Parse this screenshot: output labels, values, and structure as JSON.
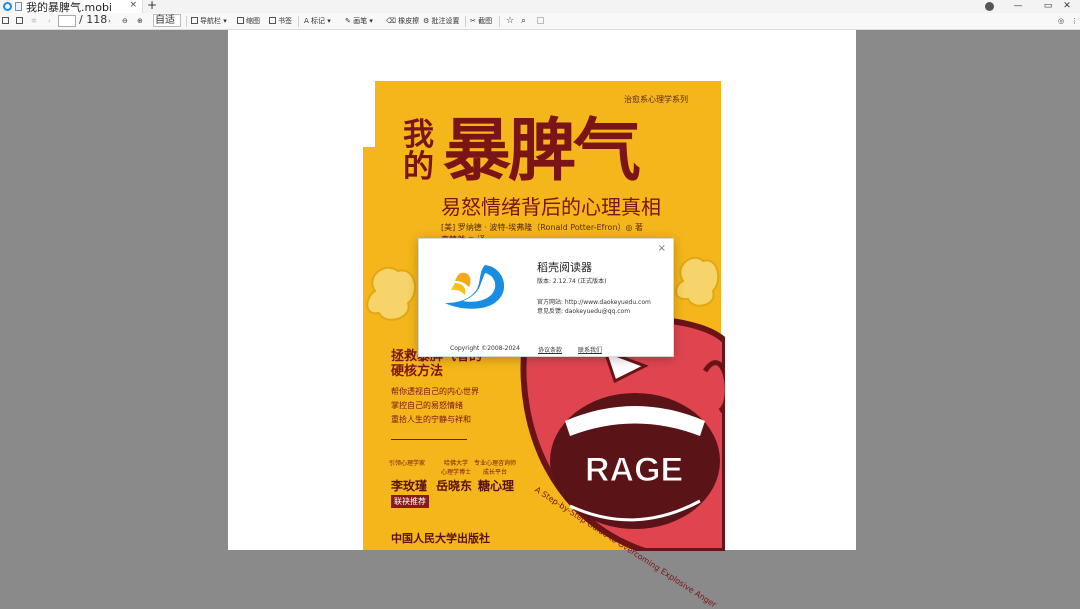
{
  "window": {
    "tab_title": "我的暴脾气.mobi",
    "close_tab": "×",
    "new_tab": "+",
    "minimize": "—",
    "restore": "▭",
    "close": "✕"
  },
  "toolbar": {
    "page_current": "",
    "page_total": "/ 118",
    "zoom": "自适",
    "navigation": "导航栏",
    "thumbnail": "缩图",
    "bookmark": "书签",
    "mark": "标记",
    "draw": "画笔",
    "eraser": "橡皮擦",
    "annot_settings": "批注设置",
    "screenshot": "截图"
  },
  "cover": {
    "series": "治愈系心理学系列",
    "title_small": "我的",
    "title_big": "暴脾气",
    "subtitle": "易怒情绪背后的心理真相",
    "author": "[美] 罗纳德 · 波特-埃弗隆（Ronald Potter-Efron）◎ 著",
    "translator": "李梦然 ◎ 译",
    "pitch_line1": "拯救暴脾气者的",
    "pitch_line2": "硬核方法",
    "pitch_points": [
      "帮你透视自己的内心世界",
      "掌控自己的易怒情绪",
      "重拾人生的宁静与祥和"
    ],
    "rec1_title": "引领心理学家",
    "rec2_title1": "哈佛大学",
    "rec2_title2": "心理学博士",
    "rec3_title1": "专业心理咨询师",
    "rec3_title2": "成长平台",
    "rec1_name": "李玫瑾",
    "rec2_name": "岳晓东",
    "rec3_name": "糖心理",
    "badge": "联袂推荐",
    "publisher": "中国人民大学出版社",
    "tagline": "A Step-by-Step Guide to Overcoming Explosive Anger",
    "rage": "RAGE"
  },
  "about": {
    "close": "×",
    "app_name": "稻壳阅读器",
    "version": "版本: 2.12.74 (正式版本)",
    "site": "官方网站: http://www.daokeyuedu.com",
    "mail": "意见反馈: daokeyuedu@qq.com",
    "copyright": "Copyright ©2008-2024",
    "license": "协议条款",
    "contact": "联系我们"
  },
  "colors": {
    "accent": "#1a8de0",
    "cover_yellow": "#f4b61a",
    "cover_red": "#7a1416"
  }
}
